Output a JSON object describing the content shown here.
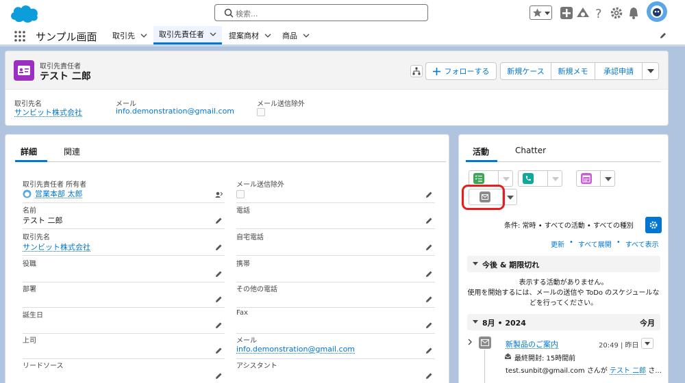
{
  "global": {
    "search_placeholder": "検索..."
  },
  "nav": {
    "app_name": "サンプル画面",
    "items": [
      {
        "label": "取引先"
      },
      {
        "label": "取引先責任者"
      },
      {
        "label": "提案商材"
      },
      {
        "label": "商品"
      }
    ]
  },
  "header": {
    "object_type": "取引先責任者",
    "record_name": "テスト 二郎",
    "buttons": {
      "follow": "フォローする",
      "new_case": "新規ケース",
      "new_memo": "新規メモ",
      "approval": "承認申請"
    },
    "highlights": [
      {
        "label": "取引先名",
        "value": "サンビット株式会社"
      },
      {
        "label": "メール",
        "value": "info.demonstration@gmail.com"
      },
      {
        "label": "メール送信除外",
        "value": ""
      }
    ]
  },
  "detail": {
    "tabs": [
      "詳細",
      "関連"
    ],
    "left_fields": [
      {
        "label": "取引先責任者 所有者",
        "value": "営業本部 太郎"
      },
      {
        "label": "名前",
        "value": "テスト 二郎"
      },
      {
        "label": "取引先名",
        "value": "サンビット株式会社"
      },
      {
        "label": "役職",
        "value": ""
      },
      {
        "label": "部署",
        "value": ""
      },
      {
        "label": "誕生日",
        "value": ""
      },
      {
        "label": "上司",
        "value": ""
      },
      {
        "label": "リードソース",
        "value": ""
      }
    ],
    "right_fields": [
      {
        "label": "メール送信除外",
        "value": ""
      },
      {
        "label": "電話",
        "value": ""
      },
      {
        "label": "自宅電話",
        "value": ""
      },
      {
        "label": "携帯",
        "value": ""
      },
      {
        "label": "その他の電話",
        "value": ""
      },
      {
        "label": "Fax",
        "value": ""
      },
      {
        "label": "メール",
        "value": "info.demonstration@gmail.com"
      },
      {
        "label": "アシスタント",
        "value": ""
      }
    ]
  },
  "activity": {
    "tabs": [
      "活動",
      "Chatter"
    ],
    "filter_text": "条件: 常時 • すべての活動 • すべての種別",
    "links": {
      "refresh": "更新",
      "expand_all": "すべて展開",
      "show_all": "すべて表示"
    },
    "upcoming": {
      "title": "今後 & 期限切れ",
      "empty_line1": "表示する活動がありません。",
      "empty_line2": "使用を開始するには、メールの送信や ToDo のスケジュールな",
      "empty_line3": "どを行ってください。"
    },
    "month": {
      "title": "8月 • 2024",
      "badge": "今月"
    },
    "item": {
      "subject": "新製品のご案内",
      "time": "20:49 | 昨日",
      "opened": "最終開封: 15時間前",
      "from": "test.sunbit@gmail.com",
      "joiner": "さんが",
      "to": "テスト 二郎",
      "more": "さ..."
    }
  }
}
